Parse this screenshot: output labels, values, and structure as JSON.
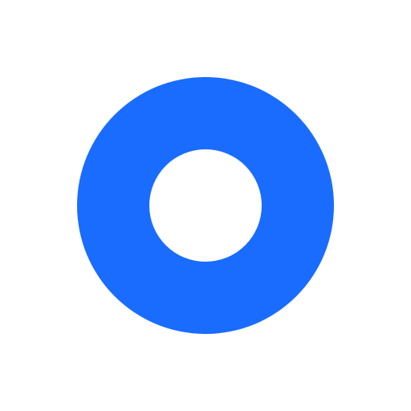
{
  "icon": {
    "name": "ring-icon",
    "shape": "ring",
    "colors": {
      "ring": "#1A6CFF",
      "background": "#FFFFFF",
      "center": "#FFFFFF"
    }
  }
}
